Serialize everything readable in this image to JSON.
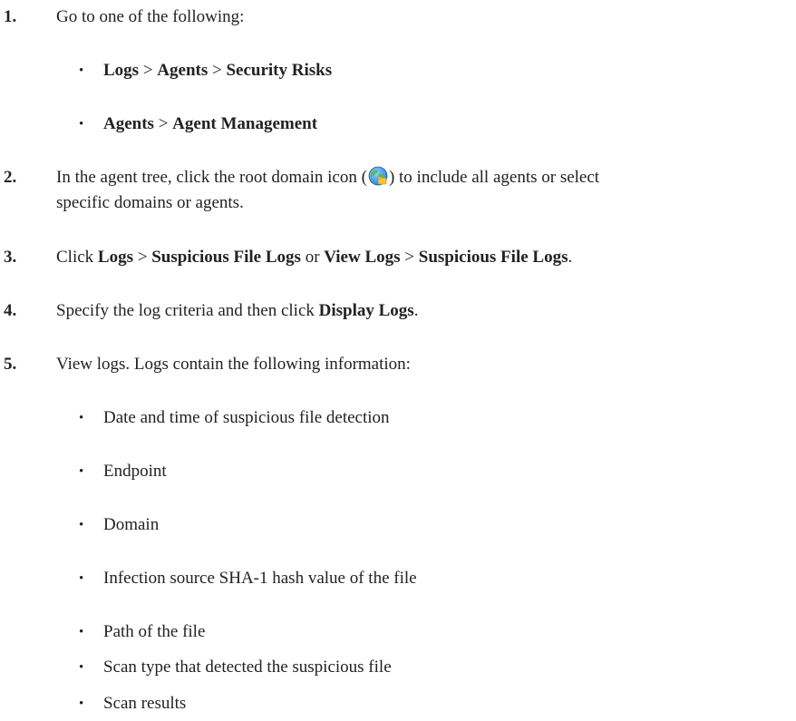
{
  "step1": {
    "number": "1.",
    "text": "Go to one of the following:",
    "nav_options": [
      {
        "a": "Logs",
        "sep1": " > ",
        "b": "Agents",
        "sep2": " > ",
        "c": "Security Risks"
      },
      {
        "a": "Agents",
        "sep1": " > ",
        "b": "Agent Management"
      }
    ]
  },
  "step2": {
    "number": "2.",
    "pre": "In the agent tree, click the root domain icon (",
    "icon": "root-domain-globe-icon",
    "post_line1": ") to include all agents or select",
    "line2": "specific domains or agents."
  },
  "step3": {
    "number": "3.",
    "t1": "Click ",
    "b1": "Logs",
    "t2": " > ",
    "b2": "Suspicious File Logs",
    "t3": " or ",
    "b3": "View Logs",
    "t4": " > ",
    "b4": "Suspicious File Logs",
    "t5": "."
  },
  "step4": {
    "number": "4.",
    "t1": "Specify the log criteria and then click ",
    "b1": "Display Logs",
    "t2": "."
  },
  "step5": {
    "number": "5.",
    "text": "View logs. Logs contain the following information:",
    "bullet_char": "•",
    "items": [
      "Date and time of suspicious file detection",
      "Endpoint",
      "Domain",
      "Infection source SHA-1 hash value of the file",
      "Path of the file",
      "Scan type that detected the suspicious file",
      "Scan results"
    ]
  }
}
